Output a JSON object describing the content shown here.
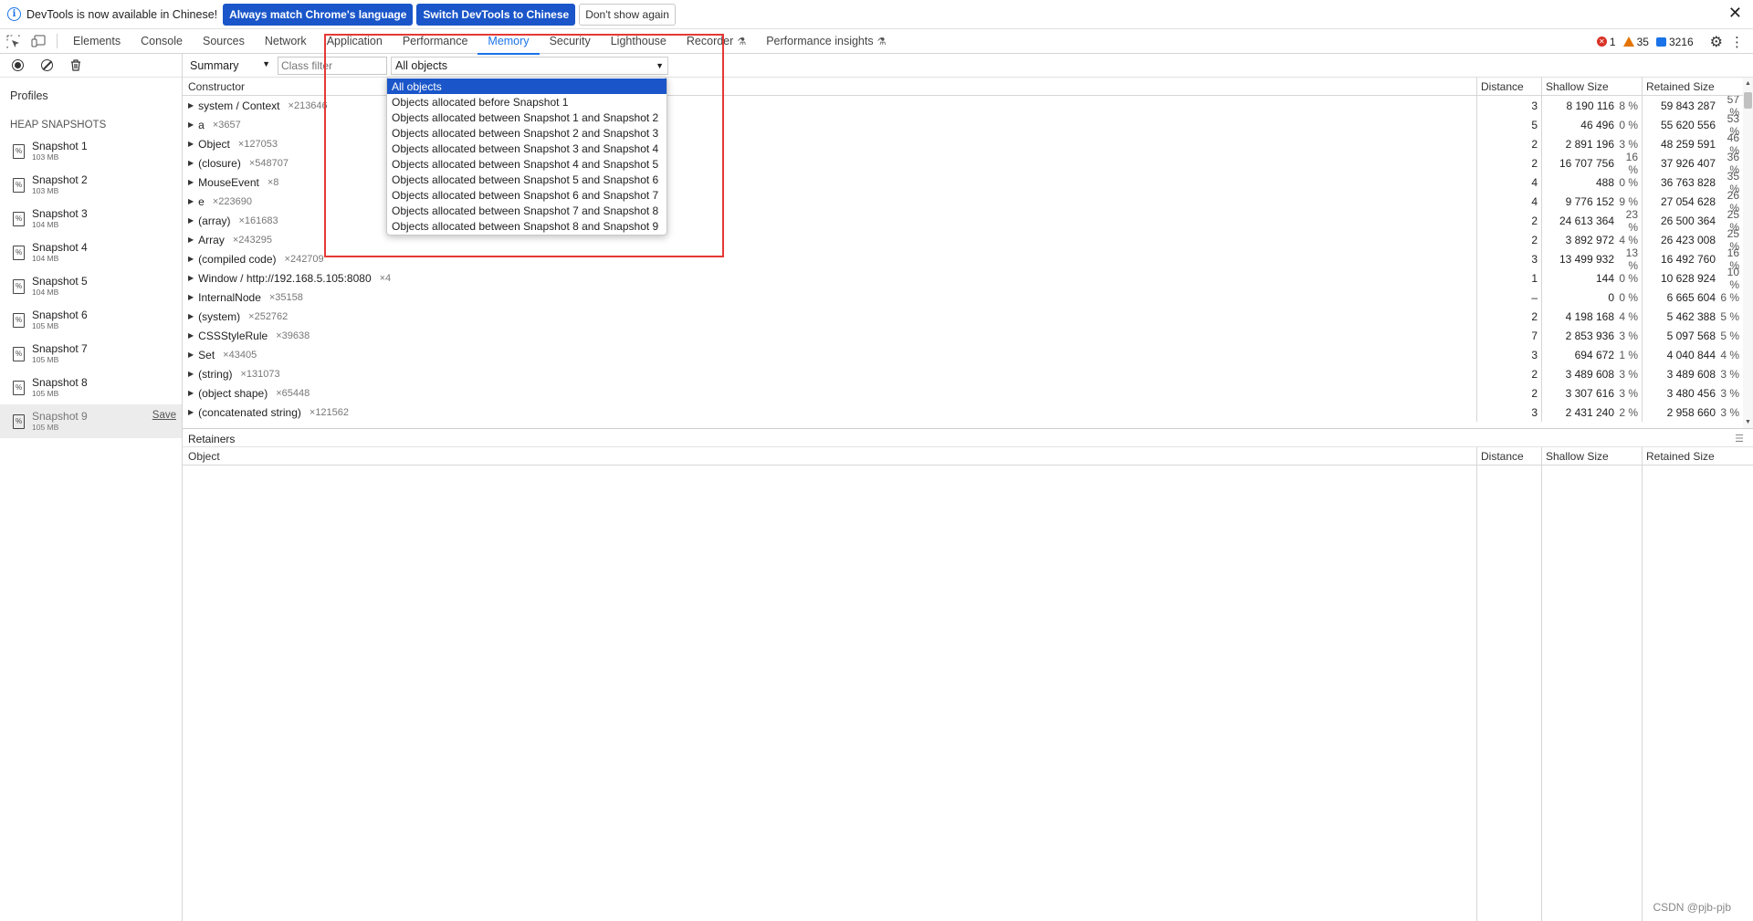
{
  "infobar": {
    "message": "DevTools is now available in Chinese!",
    "btn_match": "Always match Chrome's language",
    "btn_switch": "Switch DevTools to Chinese",
    "btn_dismiss": "Don't show again",
    "close": "✕"
  },
  "tabs": [
    {
      "label": "Elements",
      "active": false
    },
    {
      "label": "Console",
      "active": false
    },
    {
      "label": "Sources",
      "active": false
    },
    {
      "label": "Network",
      "active": false
    },
    {
      "label": "Application",
      "active": false
    },
    {
      "label": "Performance",
      "active": false
    },
    {
      "label": "Memory",
      "active": true
    },
    {
      "label": "Security",
      "active": false
    },
    {
      "label": "Lighthouse",
      "active": false
    },
    {
      "label": "Recorder",
      "active": false,
      "flask": true
    },
    {
      "label": "Performance insights",
      "active": false,
      "flask": true
    }
  ],
  "status": {
    "errors": "1",
    "warnings": "35",
    "messages": "3216"
  },
  "sidebar": {
    "profiles_label": "Profiles",
    "heading": "HEAP SNAPSHOTS",
    "save_label": "Save",
    "snapshots": [
      {
        "name": "Snapshot 1",
        "size": "103 MB"
      },
      {
        "name": "Snapshot 2",
        "size": "103 MB"
      },
      {
        "name": "Snapshot 3",
        "size": "104 MB"
      },
      {
        "name": "Snapshot 4",
        "size": "104 MB"
      },
      {
        "name": "Snapshot 5",
        "size": "104 MB"
      },
      {
        "name": "Snapshot 6",
        "size": "105 MB"
      },
      {
        "name": "Snapshot 7",
        "size": "105 MB"
      },
      {
        "name": "Snapshot 8",
        "size": "105 MB"
      },
      {
        "name": "Snapshot 9",
        "size": "105 MB",
        "selected": true
      }
    ]
  },
  "filter": {
    "view": "Summary",
    "class_filter_placeholder": "Class filter",
    "objects": "All objects"
  },
  "grid": {
    "headers": {
      "constructor": "Constructor",
      "distance": "Distance",
      "shallow": "Shallow Size",
      "retained": "Retained Size"
    },
    "rows": [
      {
        "name": "system / Context",
        "count": "×213646",
        "distance": "3",
        "shallow": "8 190 116",
        "shallow_pct": "8 %",
        "retained": "59 843 287",
        "retained_pct": "57 %"
      },
      {
        "name": "a",
        "count": "×3657",
        "distance": "5",
        "shallow": "46 496",
        "shallow_pct": "0 %",
        "retained": "55 620 556",
        "retained_pct": "53 %"
      },
      {
        "name": "Object",
        "count": "×127053",
        "distance": "2",
        "shallow": "2 891 196",
        "shallow_pct": "3 %",
        "retained": "48 259 591",
        "retained_pct": "46 %"
      },
      {
        "name": "(closure)",
        "count": "×548707",
        "distance": "2",
        "shallow": "16 707 756",
        "shallow_pct": "16 %",
        "retained": "37 926 407",
        "retained_pct": "36 %"
      },
      {
        "name": "MouseEvent",
        "count": "×8",
        "distance": "4",
        "shallow": "488",
        "shallow_pct": "0 %",
        "retained": "36 763 828",
        "retained_pct": "35 %"
      },
      {
        "name": "e",
        "count": "×223690",
        "distance": "4",
        "shallow": "9 776 152",
        "shallow_pct": "9 %",
        "retained": "27 054 628",
        "retained_pct": "26 %"
      },
      {
        "name": "(array)",
        "count": "×161683",
        "distance": "2",
        "shallow": "24 613 364",
        "shallow_pct": "23 %",
        "retained": "26 500 364",
        "retained_pct": "25 %"
      },
      {
        "name": "Array",
        "count": "×243295",
        "distance": "2",
        "shallow": "3 892 972",
        "shallow_pct": "4 %",
        "retained": "26 423 008",
        "retained_pct": "25 %"
      },
      {
        "name": "(compiled code)",
        "count": "×242709",
        "distance": "3",
        "shallow": "13 499 932",
        "shallow_pct": "13 %",
        "retained": "16 492 760",
        "retained_pct": "16 %"
      },
      {
        "name": "Window / http://192.168.5.105:8080",
        "count": "×4",
        "distance": "1",
        "shallow": "144",
        "shallow_pct": "0 %",
        "retained": "10 628 924",
        "retained_pct": "10 %"
      },
      {
        "name": "InternalNode",
        "count": "×35158",
        "distance": "–",
        "shallow": "0",
        "shallow_pct": "0 %",
        "retained": "6 665 604",
        "retained_pct": "6 %"
      },
      {
        "name": "(system)",
        "count": "×252762",
        "distance": "2",
        "shallow": "4 198 168",
        "shallow_pct": "4 %",
        "retained": "5 462 388",
        "retained_pct": "5 %"
      },
      {
        "name": "CSSStyleRule",
        "count": "×39638",
        "distance": "7",
        "shallow": "2 853 936",
        "shallow_pct": "3 %",
        "retained": "5 097 568",
        "retained_pct": "5 %"
      },
      {
        "name": "Set",
        "count": "×43405",
        "distance": "3",
        "shallow": "694 672",
        "shallow_pct": "1 %",
        "retained": "4 040 844",
        "retained_pct": "4 %"
      },
      {
        "name": "(string)",
        "count": "×131073",
        "distance": "2",
        "shallow": "3 489 608",
        "shallow_pct": "3 %",
        "retained": "3 489 608",
        "retained_pct": "3 %"
      },
      {
        "name": "(object shape)",
        "count": "×65448",
        "distance": "2",
        "shallow": "3 307 616",
        "shallow_pct": "3 %",
        "retained": "3 480 456",
        "retained_pct": "3 %"
      },
      {
        "name": "(concatenated string)",
        "count": "×121562",
        "distance": "3",
        "shallow": "2 431 240",
        "shallow_pct": "2 %",
        "retained": "2 958 660",
        "retained_pct": "3 %"
      }
    ]
  },
  "retainers": {
    "title": "Retainers",
    "headers": {
      "object": "Object",
      "distance": "Distance",
      "shallow": "Shallow Size",
      "retained": "Retained Size"
    }
  },
  "dropdown": {
    "options": [
      "All objects",
      "Objects allocated before Snapshot 1",
      "Objects allocated between Snapshot 1 and Snapshot 2",
      "Objects allocated between Snapshot 2 and Snapshot 3",
      "Objects allocated between Snapshot 3 and Snapshot 4",
      "Objects allocated between Snapshot 4 and Snapshot 5",
      "Objects allocated between Snapshot 5 and Snapshot 6",
      "Objects allocated between Snapshot 6 and Snapshot 7",
      "Objects allocated between Snapshot 7 and Snapshot 8",
      "Objects allocated between Snapshot 8 and Snapshot 9"
    ],
    "selected_index": 0
  },
  "watermark": "CSDN @pjb-pjb",
  "colors": {
    "accent": "#1a73e8",
    "primary_button": "#1a56c9",
    "highlight_box": "#e53935"
  }
}
